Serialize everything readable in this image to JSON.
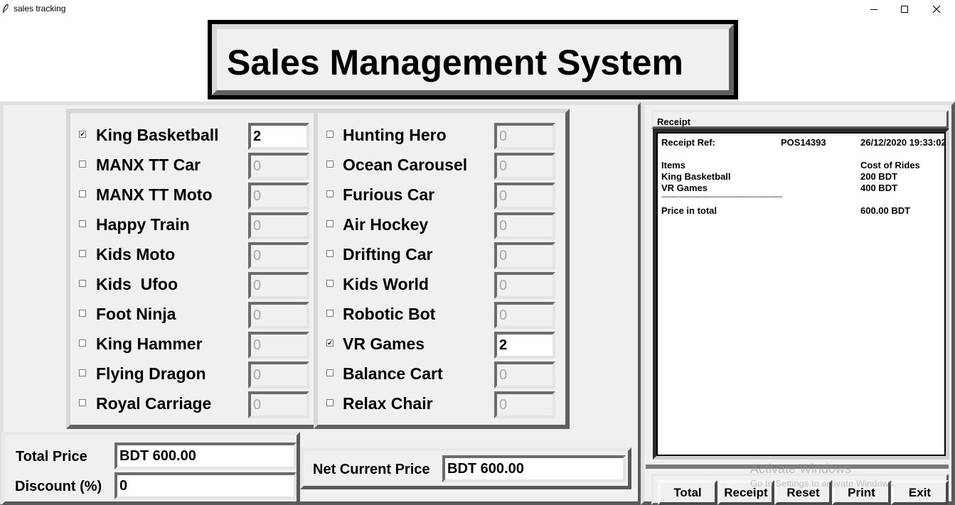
{
  "window": {
    "title": "sales tracking",
    "icon": "feather-icon",
    "controls": [
      "minimize-icon",
      "maximize-icon",
      "close-icon"
    ]
  },
  "header": {
    "title": "Sales Management System"
  },
  "items_left": [
    {
      "name": "King Basketball",
      "checked": true,
      "qty": "2"
    },
    {
      "name": "MANX TT Car",
      "checked": false,
      "qty": "0"
    },
    {
      "name": "MANX TT Moto",
      "checked": false,
      "qty": "0"
    },
    {
      "name": "Happy Train",
      "checked": false,
      "qty": "0"
    },
    {
      "name": "Kids Moto",
      "checked": false,
      "qty": "0"
    },
    {
      "name": "Kids  Ufoo",
      "checked": false,
      "qty": "0"
    },
    {
      "name": "Foot Ninja",
      "checked": false,
      "qty": "0"
    },
    {
      "name": "King Hammer",
      "checked": false,
      "qty": "0"
    },
    {
      "name": "Flying Dragon",
      "checked": false,
      "qty": "0"
    },
    {
      "name": "Royal Carriage",
      "checked": false,
      "qty": "0"
    }
  ],
  "items_right": [
    {
      "name": "Hunting Hero",
      "checked": false,
      "qty": "0"
    },
    {
      "name": "Ocean Carousel",
      "checked": false,
      "qty": "0"
    },
    {
      "name": "Furious Car",
      "checked": false,
      "qty": "0"
    },
    {
      "name": "Air Hockey",
      "checked": false,
      "qty": "0"
    },
    {
      "name": "Drifting Car",
      "checked": false,
      "qty": "0"
    },
    {
      "name": "Kids World",
      "checked": false,
      "qty": "0"
    },
    {
      "name": "Robotic Bot",
      "checked": false,
      "qty": "0"
    },
    {
      "name": "VR Games",
      "checked": true,
      "qty": "2"
    },
    {
      "name": "Balance Cart",
      "checked": false,
      "qty": "0"
    },
    {
      "name": "Relax Chair",
      "checked": false,
      "qty": "0"
    }
  ],
  "totals": {
    "total_price_label": "Total Price",
    "total_price_value": "BDT 600.00",
    "discount_label": "Discount (%)",
    "discount_value": "0",
    "net_label": "Net Current Price",
    "net_value": "BDT 600.00"
  },
  "receipt": {
    "section_label": "Receipt",
    "ref_label": "Receipt Ref:",
    "ref_value": "POS14393",
    "datetime": "26/12/2020 19:33:02",
    "col_items": "Items",
    "col_cost": "Cost of Rides",
    "lines": [
      {
        "item": "King Basketball",
        "cost": "200 BDT"
      },
      {
        "item": "VR Games",
        "cost": "400 BDT"
      }
    ],
    "separator": "------------------------------------------------------------",
    "total_label": "Price in total",
    "total_value": "600.00 BDT"
  },
  "buttons": {
    "total": "Total",
    "receipt": "Receipt",
    "reset": "Reset",
    "print": "Print",
    "exit": "Exit"
  },
  "watermark": {
    "line1": "Activate Windows",
    "line2": "Go to Settings to activate Windows."
  }
}
